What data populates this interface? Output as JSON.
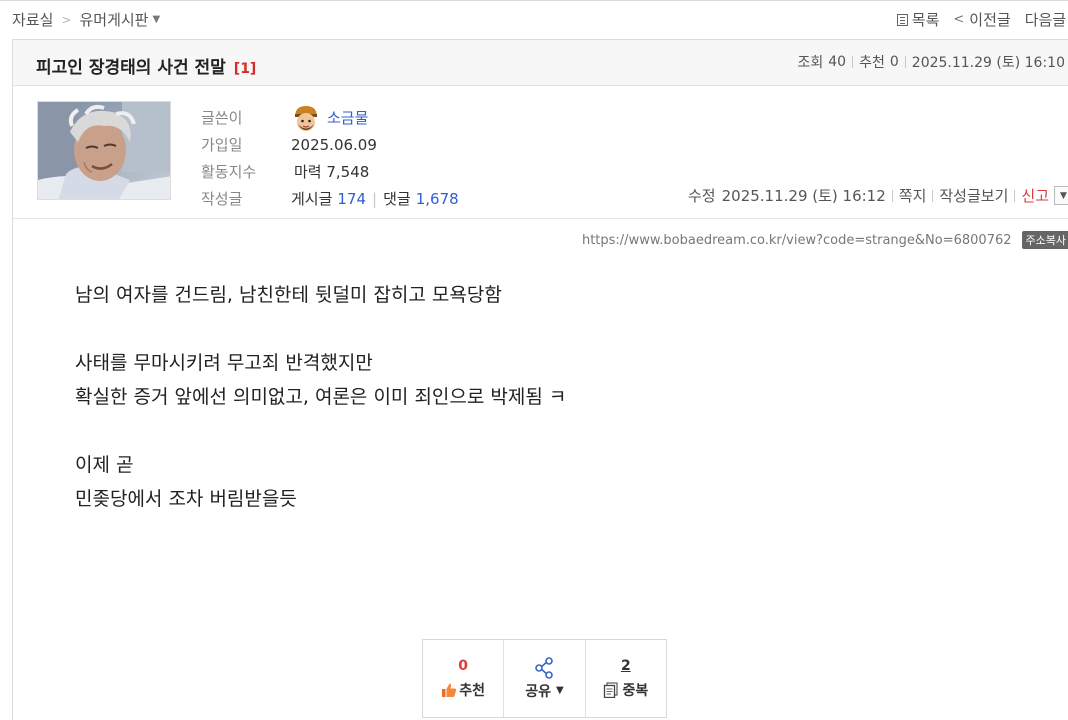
{
  "nav": {
    "breadcrumb": [
      "자료실",
      "유머게시판"
    ],
    "links": {
      "list": "목록",
      "prev": "이전글",
      "next": "다음글"
    }
  },
  "post": {
    "title": "피고인 장경태의 사건 전말",
    "comment_count": "[1]",
    "views_label": "조회",
    "views": "40",
    "recommend_label": "추천",
    "recommend": "0",
    "date": "2025.11.29 (토) 16:10"
  },
  "author": {
    "labels": {
      "writer": "글쓴이",
      "joined": "가입일",
      "activity": "활동지수",
      "posts": "작성글"
    },
    "name": "소금물",
    "joined": "2025.06.09",
    "activity": "마력 7,548",
    "posts_label": "게시글",
    "posts": "174",
    "comments_label": "댓글",
    "comments": "1,678"
  },
  "actions": {
    "edited_label": "수정",
    "edited": "2025.11.29 (토) 16:12",
    "message": "쪽지",
    "view_posts": "작성글보기",
    "report": "신고"
  },
  "url": {
    "text": "https://www.bobaedream.co.kr/view?code=strange&No=6800762",
    "copy_label": "주소복사"
  },
  "content": {
    "lines": [
      "남의 여자를 건드림, 남친한테 뒷덜미 잡히고 모욕당함",
      "",
      "사태를 무마시키려 무고죄 반격했지만",
      "확실한 증거 앞에선 의미없고, 여론은 이미 죄인으로 박제됨 ㅋ",
      "",
      "이제 곧",
      "민좆당에서 조차 버림받을듯"
    ]
  },
  "votes": {
    "recommend_count": "0",
    "recommend_label": "추천",
    "share_label": "공유",
    "duplicate_count": "2",
    "duplicate_label": "중복"
  },
  "colors": {
    "accent_blue": "#2d5fd1",
    "accent_red": "#e03a3a"
  }
}
